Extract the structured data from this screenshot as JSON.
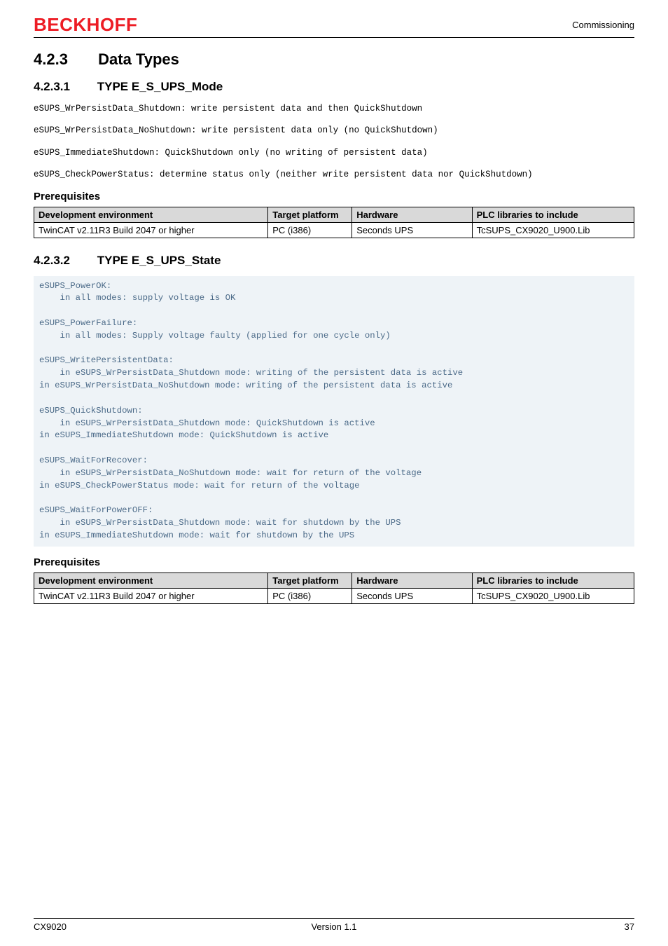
{
  "header": {
    "brand": "BECKHOFF",
    "section": "Commissioning"
  },
  "sections": {
    "data_types": {
      "num": "4.2.3",
      "title": "Data Types"
    },
    "mode": {
      "num": "4.2.3.1",
      "title": "TYPE E_S_UPS_Mode"
    },
    "state": {
      "num": "4.2.3.2",
      "title": "TYPE E_S_UPS_State"
    }
  },
  "mode_lines": {
    "l1": "eSUPS_WrPersistData_Shutdown: write persistent data and then QuickShutdown",
    "l2": "eSUPS_WrPersistData_NoShutdown: write persistent data only (no QuickShutdown)",
    "l3": "eSUPS_ImmediateShutdown: QuickShutdown only (no writing of persistent data)",
    "l4": "eSUPS_CheckPowerStatus: determine status only (neither write persistent data nor QuickShutdown)"
  },
  "prereq_label": "Prerequisites",
  "table_headers": {
    "env": "Development environment",
    "plat": "Target plat­form",
    "hw": "Hardware",
    "lib": "PLC libraries to include"
  },
  "table_row": {
    "env": "TwinCAT v2.11R3 Build 2047 or higher",
    "plat": "PC (i386)",
    "hw": "Seconds UPS",
    "lib": "TcSUPS_CX9020_U900.Lib"
  },
  "state_code": "eSUPS_PowerOK:\n    in all modes: supply voltage is OK\n\neSUPS_PowerFailure:\n    in all modes: Supply voltage faulty (applied for one cycle only)\n\neSUPS_WritePersistentData:\n    in eSUPS_WrPersistData_Shutdown mode: writing of the persistent data is active\nin eSUPS_WrPersistData_NoShutdown mode: writing of the persistent data is active\n\neSUPS_QuickShutdown:\n    in eSUPS_WrPersistData_Shutdown mode: QuickShutdown is active\nin eSUPS_ImmediateShutdown mode: QuickShutdown is active\n\neSUPS_WaitForRecover:\n    in eSUPS_WrPersistData_NoShutdown mode: wait for return of the voltage\nin eSUPS_CheckPowerStatus mode: wait for return of the voltage\n\neSUPS_WaitForPowerOFF:\n    in eSUPS_WrPersistData_Shutdown mode: wait for shutdown by the UPS\nin eSUPS_ImmediateShutdown mode: wait for shutdown by the UPS",
  "footer": {
    "left": "CX9020",
    "center": "Version 1.1",
    "right": "37"
  }
}
